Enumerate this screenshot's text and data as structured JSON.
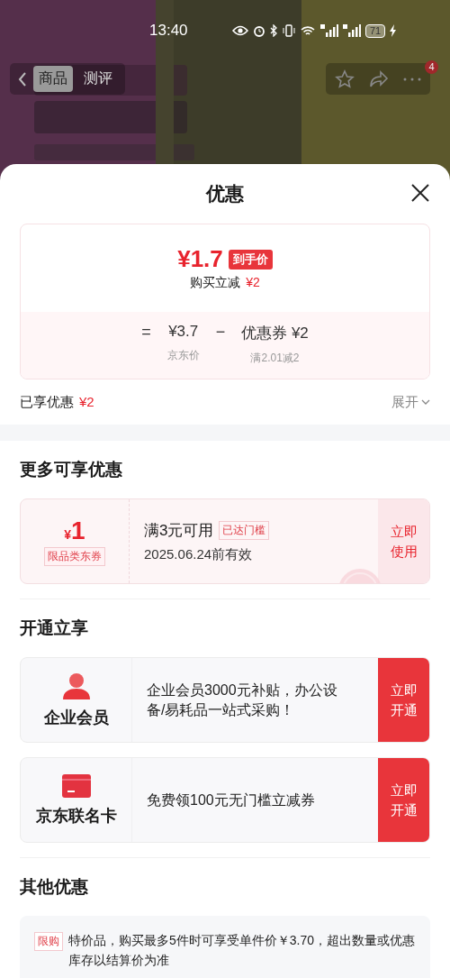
{
  "status_bar": {
    "time": "13:40",
    "battery": "71"
  },
  "nav": {
    "tabs": [
      {
        "label": "商品",
        "selected": true
      },
      {
        "label": "测评",
        "selected": false
      }
    ],
    "badge": "4"
  },
  "sheet": {
    "title": "优惠",
    "price_card": {
      "final_price": "¥1.7",
      "final_tag": "到手价",
      "saving_label": "购买立减",
      "saving_amount": "¥2",
      "formula": [
        {
          "kind": "op",
          "text": "="
        },
        {
          "kind": "term",
          "text": "¥3.7",
          "caption": "京东价"
        },
        {
          "kind": "op",
          "text": "−"
        },
        {
          "kind": "term",
          "text": "优惠券 ¥2",
          "caption": "满2.01减2"
        }
      ]
    },
    "enjoyed": {
      "label": "已享优惠",
      "amount": "¥2",
      "toggle": "展开"
    },
    "sections": [
      {
        "kind": "coupons",
        "title": "更多可享优惠",
        "items": [
          {
            "currency": "¥",
            "amount": "1",
            "type": "限品类东券",
            "condition": "满3元可用",
            "status": "已达门槛",
            "validity": "2025.06.24前有效",
            "action": "立即使用"
          }
        ]
      },
      {
        "kind": "memberships",
        "title": "开通立享",
        "items": [
          {
            "kind": "person",
            "name": "企业会员",
            "description": "企业会员3000元补贴，办公设备/易耗品一站式采购！",
            "action": "立即开通"
          },
          {
            "kind": "card",
            "name": "京东联名卡",
            "description": "免费领100元无门槛立减券",
            "action": "立即开通"
          }
        ]
      },
      {
        "kind": "notes",
        "title": "其他优惠",
        "items": [
          {
            "tag": "限购",
            "text": "特价品，购买最多5件时可享受单件价￥3.70，超出数量或优惠库存以结算价为准"
          }
        ]
      }
    ]
  }
}
